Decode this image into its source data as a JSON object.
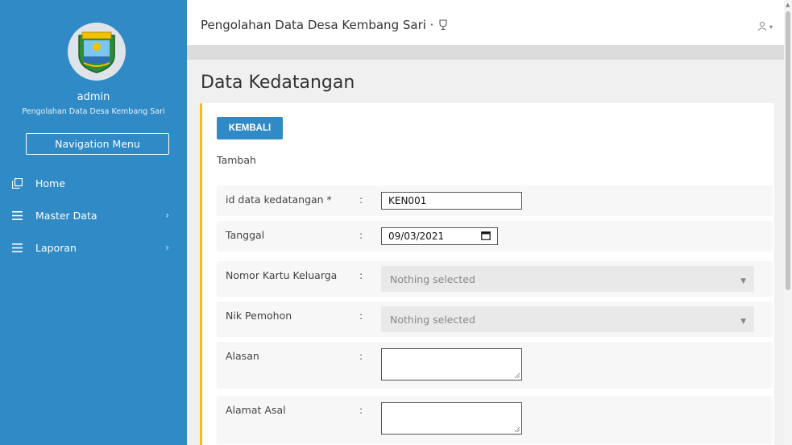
{
  "sidebar": {
    "user_name": "admin",
    "app_subtitle": "Pengolahan Data Desa Kembang Sari",
    "nav_button": "Navigation Menu",
    "items": [
      {
        "label": "Home",
        "icon": "copy-icon",
        "has_submenu": false
      },
      {
        "label": "Master Data",
        "icon": "menu-icon",
        "has_submenu": true
      },
      {
        "label": "Laporan",
        "icon": "menu-icon",
        "has_submenu": true
      }
    ]
  },
  "topbar": {
    "title": "Pengolahan Data Desa Kembang Sari ·",
    "title_icon": "trophy-icon",
    "user_icon": "user-icon"
  },
  "page": {
    "title": "Data Kedatangan",
    "back_button": "KEMBALI",
    "section": "Tambah"
  },
  "form": {
    "colon": ":",
    "id": {
      "label": "id data kedatangan *",
      "value": "KEN001"
    },
    "tanggal": {
      "label": "Tanggal",
      "value": "09/03/2021"
    },
    "kk": {
      "label": "Nomor Kartu Keluarga",
      "value": "Nothing selected"
    },
    "nik": {
      "label": "Nik Pemohon",
      "value": "Nothing selected"
    },
    "alasan": {
      "label": "Alasan",
      "value": ""
    },
    "alamat_asal": {
      "label": "Alamat Asal",
      "value": ""
    }
  },
  "colors": {
    "sidebar_bg": "#2f8ac6",
    "accent_border": "#f2c200",
    "button_bg": "#2f8ac6"
  }
}
